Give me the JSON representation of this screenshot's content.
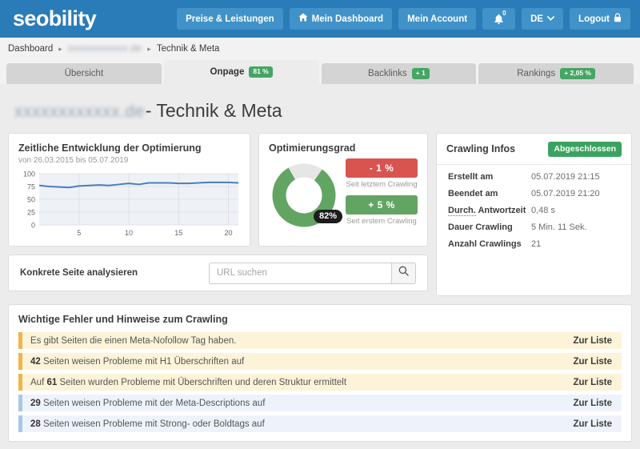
{
  "topbar": {
    "logo": "seobility",
    "buttons": [
      {
        "label": "Preise & Leistungen",
        "icon": ""
      },
      {
        "label": "Mein Dashboard",
        "icon": "home-icon"
      },
      {
        "label": "Mein Account",
        "icon": ""
      },
      {
        "label": "",
        "icon": "bell-icon",
        "count": "0"
      },
      {
        "label": "DE",
        "icon": "chevron-down-icon"
      },
      {
        "label": "Logout",
        "icon": "lock-icon"
      }
    ]
  },
  "breadcrumb": {
    "home": "Dashboard",
    "domain": "xxxxxxxxxxxx.de",
    "current": "Technik & Meta",
    "separator": "▸"
  },
  "tabs": [
    {
      "label": "Übersicht",
      "badge": "",
      "active": false
    },
    {
      "label": "Onpage",
      "badge": "81 %",
      "active": true
    },
    {
      "label": "Backlinks",
      "badge": "+ 1",
      "active": false
    },
    {
      "label": "Rankings",
      "badge": "+ 2,05 %",
      "active": false
    }
  ],
  "page_title": {
    "domain": "xxxxxxxxxxxx.de",
    "suffix": " - Technik & Meta"
  },
  "chart_card": {
    "title": "Zeitliche Entwicklung der Optimierung",
    "subtitle": "von 26.03.2015 bis 05.07.2019"
  },
  "chart_data": {
    "type": "line",
    "title": "Zeitliche Entwicklung der Optimierung",
    "subtitle": "von 26.03.2015 bis 05.07.2019",
    "xlabel": "",
    "ylabel": "",
    "ylim": [
      0,
      100
    ],
    "xlim": [
      1,
      21
    ],
    "yticks": [
      0,
      25,
      50,
      75,
      100
    ],
    "xticks": [
      5,
      10,
      15,
      20
    ],
    "grid": true,
    "legend": "none",
    "line_color": "#4a7ebb",
    "fill_color": "#eef2f7",
    "x": [
      1,
      2,
      3,
      4,
      5,
      6,
      7,
      8,
      9,
      10,
      11,
      12,
      13,
      14,
      15,
      16,
      17,
      18,
      19,
      20,
      21
    ],
    "values": [
      77,
      75,
      74,
      73,
      76,
      77,
      78,
      77,
      79,
      81,
      79,
      82,
      82,
      82,
      81,
      81,
      82,
      83,
      83,
      83,
      82
    ]
  },
  "donut_card": {
    "title": "Optimierungsgrad",
    "percent_label": "82%",
    "percent_value": 82,
    "donut_color": "#62a563",
    "donut_rest_color": "#e6e6e6",
    "delta_last": "- 1 %",
    "delta_last_caption": "Seit letztem Crawling",
    "delta_first": "+ 5 %",
    "delta_first_caption": "Seit erstem Crawling"
  },
  "crawling": {
    "title": "Crawling Infos",
    "status": "Abgeschlossen",
    "rows": [
      {
        "key": "Erstellt am",
        "value": "05.07.2019 21:15",
        "abbr": false
      },
      {
        "key": "Beendet am",
        "value": "05.07.2019 21:20",
        "abbr": false
      },
      {
        "key": "Durch.",
        "key2": " Antwortzeit",
        "value": "0,48 s",
        "abbr": true
      },
      {
        "key": "Dauer Crawling",
        "value": "5 Min. 11 Sek.",
        "abbr": false
      },
      {
        "key": "Anzahl Crawlings",
        "value": "21",
        "abbr": false
      }
    ]
  },
  "url_search": {
    "label": "Konkrete Seite analysieren",
    "placeholder": "URL suchen",
    "value": ""
  },
  "errors": {
    "title": "Wichtige Fehler und Hinweise zum Crawling",
    "link_label": "Zur Liste",
    "rows": [
      {
        "prefix": "",
        "count": "",
        "text": "Es gibt Seiten die einen Meta-Nofollow Tag haben.",
        "type": "warn"
      },
      {
        "prefix": "",
        "count": "42",
        "text": " Seiten weisen Probleme mit H1 Überschriften auf",
        "type": "warn"
      },
      {
        "prefix": "Auf ",
        "count": "61",
        "text": " Seiten wurden Probleme mit Überschriften und deren Struktur ermittelt",
        "type": "warn"
      },
      {
        "prefix": "",
        "count": "29",
        "text": " Seiten weisen Probleme mit der Meta-Descriptions auf",
        "type": "info"
      },
      {
        "prefix": "",
        "count": "28",
        "text": " Seiten weisen Probleme mit Strong- oder Boldtags auf",
        "type": "info"
      }
    ]
  },
  "colors": {
    "brand_blue": "#2a7cb8",
    "nav_button": "#4092c8",
    "green": "#45a563",
    "red": "#d9534f",
    "warn_bg": "#fdf3d8",
    "warn_border": "#f0b44a",
    "info_bg": "#eef3fb",
    "info_border": "#a9c5e8"
  }
}
